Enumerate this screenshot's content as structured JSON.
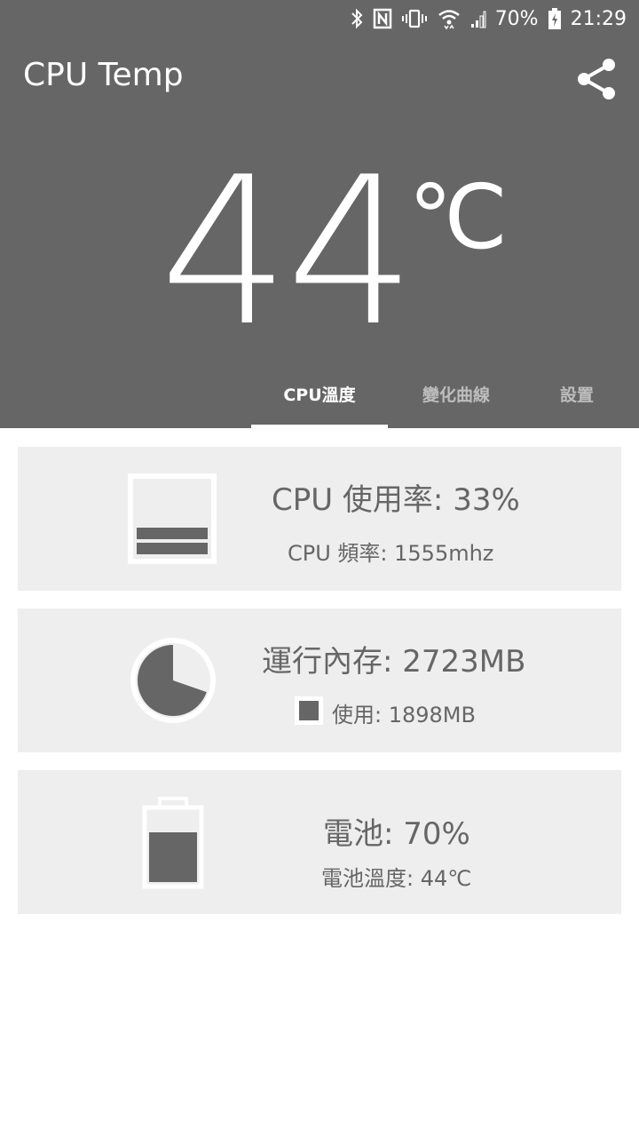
{
  "status_bar": {
    "battery": "70%",
    "time": "21:29",
    "icons": [
      "bluetooth-icon",
      "nfc-icon",
      "vibrate-icon",
      "wifi-icon",
      "signal-icon",
      "battery-charging-icon"
    ]
  },
  "app_bar": {
    "title": "CPU Temp",
    "share_icon": "share-icon"
  },
  "temperature": {
    "value": "44",
    "unit": "℃"
  },
  "tabs": [
    {
      "label": "CPU溫度",
      "active": true
    },
    {
      "label": "變化曲線",
      "active": false
    },
    {
      "label": "設置",
      "active": false
    }
  ],
  "cards": {
    "cpu": {
      "title": "CPU 使用率: 33%",
      "subtitle": "CPU 頻率: 1555mhz",
      "usage_fraction": 0.33
    },
    "memory": {
      "title": "運行內存: 2723MB",
      "subtitle": "使用: 1898MB",
      "used_fraction": 0.697
    },
    "battery": {
      "title": "電池: 70%",
      "subtitle": "電池溫度: 44℃",
      "level_fraction": 0.7
    }
  },
  "colors": {
    "header_bg": "#666666",
    "card_bg": "#eeeeee",
    "text": "#666666",
    "white": "#ffffff"
  }
}
